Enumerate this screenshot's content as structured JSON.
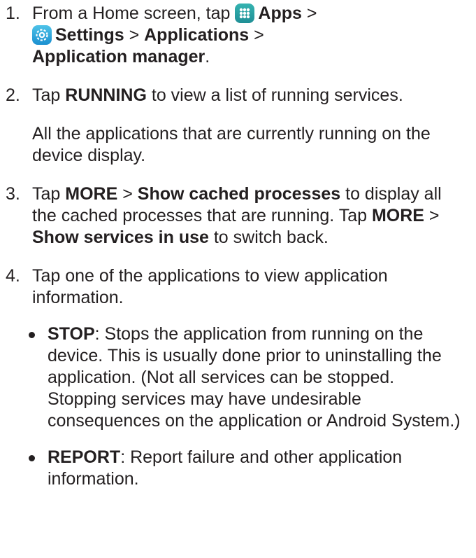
{
  "steps": [
    {
      "num": "1",
      "t1": "From a Home screen, tap ",
      "apps_icon": "apps-grid-icon",
      "b1": "Apps",
      "t2": " >",
      "settings_icon": "settings-gear-icon",
      "b2": "Settings",
      "t3": " > ",
      "b3": "Applications",
      "t4": " >",
      "b4": "Application manager",
      "t5": "."
    },
    {
      "num": "2",
      "t1": "Tap ",
      "b1": "RUNNING",
      "t2": " to view a list of running services.",
      "sub": "All the applications that are currently running on the device display."
    },
    {
      "num": "3",
      "t1": "Tap ",
      "b1": "MORE",
      "t2": " > ",
      "b2": "Show cached processes",
      "t3": " to display all the cached processes that are running. Tap ",
      "b3": "MORE",
      "t4": " > ",
      "b4": "Show services in use",
      "t5": " to switch back."
    },
    {
      "num": "4",
      "t1": "Tap one of the applications to view application information.",
      "bullets": [
        {
          "term": "STOP",
          "text": ": Stops the application from running on the device. This is usually done prior to uninstalling the application. (Not all services can be stopped. Stopping services may have undesirable consequences on the application or Android System.)"
        },
        {
          "term": "REPORT",
          "text": ": Report failure and other application information."
        }
      ]
    }
  ],
  "colors": {
    "text": "#231f20",
    "apps_icon_bg": "#2b9aa0",
    "settings_icon_bg": "#1a8fd0"
  }
}
